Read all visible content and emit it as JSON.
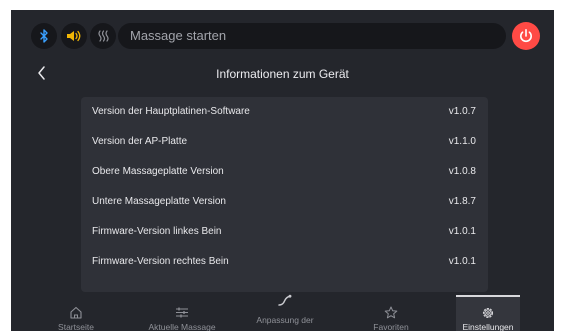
{
  "topbar": {
    "bluetooth_icon": "bluetooth-icon",
    "sound_icon": "speaker-icon",
    "heat_icon": "heat-icon",
    "massage_placeholder": "Massage starten",
    "power_icon": "power-icon",
    "power_color": "#ff4a45"
  },
  "header": {
    "back_icon": "chevron-left-icon",
    "title": "Informationen zum Gerät"
  },
  "info_rows": [
    {
      "label": "Version der Hauptplatinen-Software",
      "value": "v1.0.7"
    },
    {
      "label": "Version der AP-Platte",
      "value": "v1.1.0"
    },
    {
      "label": "Obere Massageplatte Version",
      "value": "v1.0.8"
    },
    {
      "label": "Untere Massageplatte Version",
      "value": "v1.8.7"
    },
    {
      "label": "Firmware-Version linkes Bein",
      "value": "v1.0.1"
    },
    {
      "label": "Firmware-Version rechtes Bein",
      "value": "v1.0.1"
    }
  ],
  "nav": {
    "items": [
      {
        "label": "Startseite",
        "icon": "home-icon"
      },
      {
        "label": "Aktuelle Massage",
        "icon": "sliders-icon"
      },
      {
        "label": "Anpassung der",
        "icon": "curve-icon"
      },
      {
        "label": "Favoriten",
        "icon": "star-icon"
      },
      {
        "label": "Einstellungen",
        "icon": "gear-icon"
      }
    ],
    "active": "Einstellungen"
  },
  "colors": {
    "background": "#24262c",
    "panel": "#2f3138",
    "bluetooth": "#3aa0ff",
    "sound": "#f2b705"
  }
}
